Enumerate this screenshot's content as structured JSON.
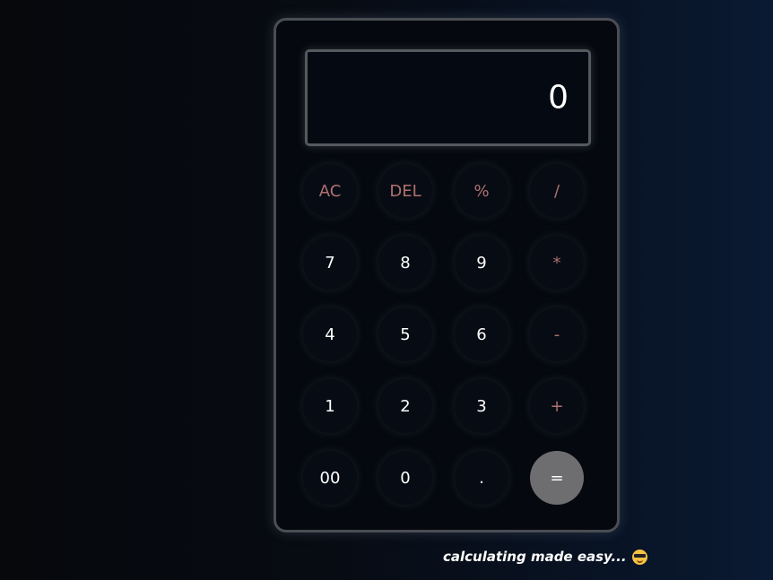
{
  "display": {
    "value": "0"
  },
  "keys": {
    "ac": "AC",
    "del": "DEL",
    "percent": "%",
    "divide": "/",
    "seven": "7",
    "eight": "8",
    "nine": "9",
    "multiply": "*",
    "four": "4",
    "five": "5",
    "six": "6",
    "subtract": "-",
    "one": "1",
    "two": "2",
    "three": "3",
    "add": "+",
    "double_zero": "00",
    "zero": "0",
    "decimal": ".",
    "equals": "="
  },
  "tagline": {
    "text": "calculating made easy...",
    "icon": "sunglasses-emoji-icon"
  },
  "colors": {
    "operator_text": "#b07070",
    "equals_bg": "#6e6e70",
    "border": "#4a4d52"
  }
}
